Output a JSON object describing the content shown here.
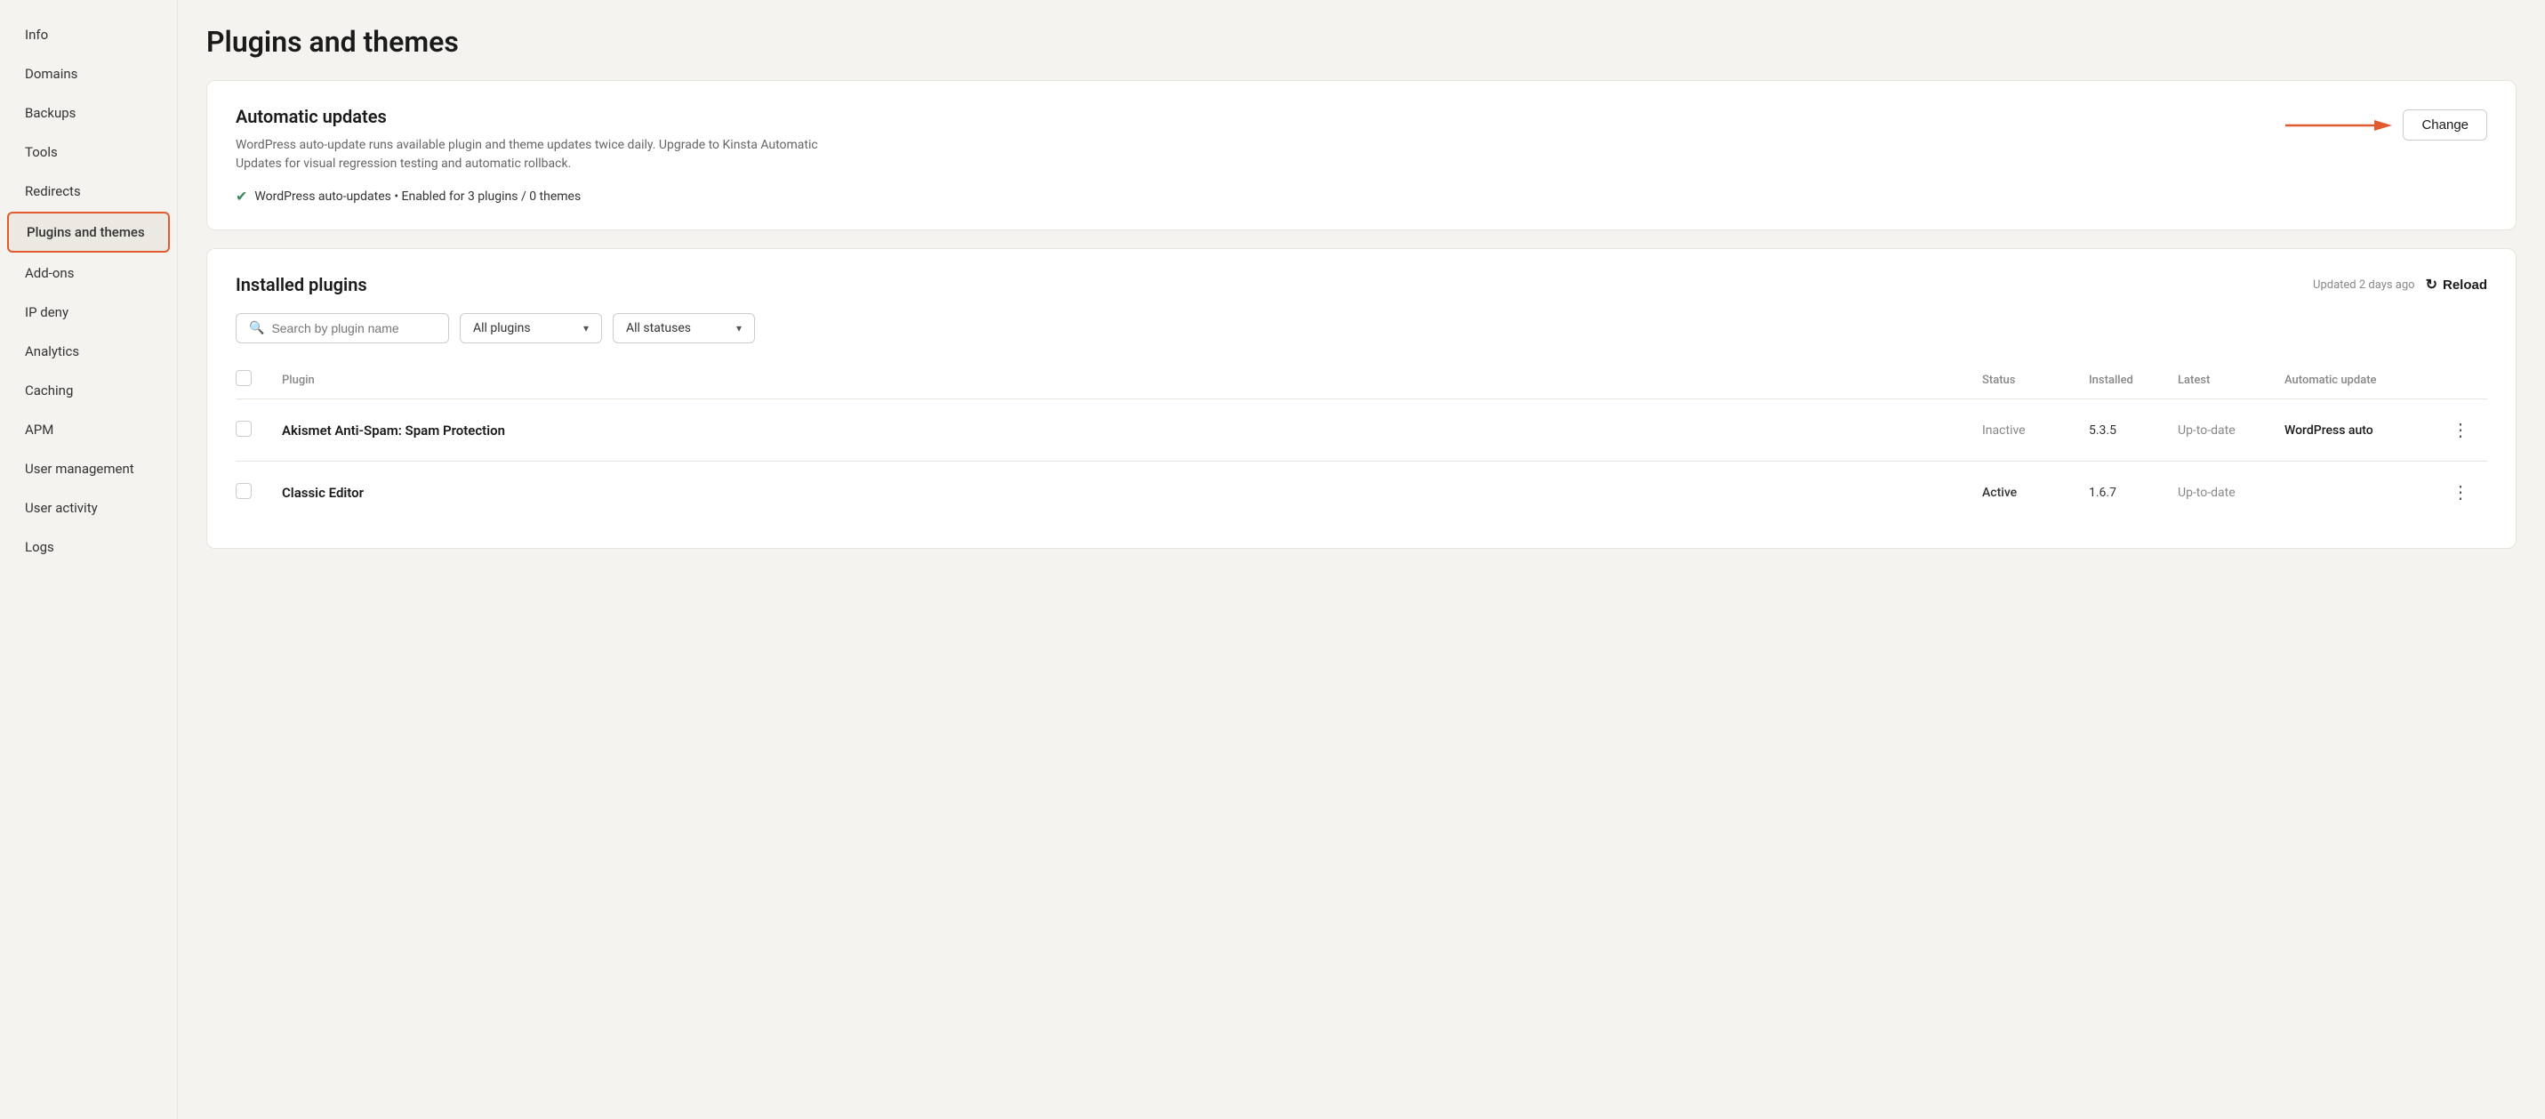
{
  "sidebar": {
    "items": [
      {
        "id": "info",
        "label": "Info",
        "active": false
      },
      {
        "id": "domains",
        "label": "Domains",
        "active": false
      },
      {
        "id": "backups",
        "label": "Backups",
        "active": false
      },
      {
        "id": "tools",
        "label": "Tools",
        "active": false
      },
      {
        "id": "redirects",
        "label": "Redirects",
        "active": false
      },
      {
        "id": "plugins-and-themes",
        "label": "Plugins and themes",
        "active": true
      },
      {
        "id": "add-ons",
        "label": "Add-ons",
        "active": false
      },
      {
        "id": "ip-deny",
        "label": "IP deny",
        "active": false
      },
      {
        "id": "analytics",
        "label": "Analytics",
        "active": false
      },
      {
        "id": "caching",
        "label": "Caching",
        "active": false
      },
      {
        "id": "apm",
        "label": "APM",
        "active": false
      },
      {
        "id": "user-management",
        "label": "User management",
        "active": false
      },
      {
        "id": "user-activity",
        "label": "User activity",
        "active": false
      },
      {
        "id": "logs",
        "label": "Logs",
        "active": false
      }
    ]
  },
  "page": {
    "title": "Plugins and themes"
  },
  "auto_updates": {
    "heading": "Automatic updates",
    "description": "WordPress auto-update runs available plugin and theme updates twice daily. Upgrade to Kinsta Automatic Updates for visual regression testing and automatic rollback.",
    "status": "WordPress auto-updates • Enabled for 3 plugins / 0 themes",
    "change_label": "Change"
  },
  "installed_plugins": {
    "heading": "Installed plugins",
    "updated_text": "Updated 2 days ago",
    "reload_label": "Reload",
    "search_placeholder": "Search by plugin name",
    "filter_plugins_label": "All plugins",
    "filter_status_label": "All statuses",
    "table_headers": {
      "plugin": "Plugin",
      "status": "Status",
      "installed": "Installed",
      "latest": "Latest",
      "auto_update": "Automatic update"
    },
    "plugins": [
      {
        "name": "Akismet Anti-Spam: Spam Protection",
        "status": "Inactive",
        "installed": "5.3.5",
        "latest": "Up-to-date",
        "auto_update": "WordPress auto"
      },
      {
        "name": "Classic Editor",
        "status": "Active",
        "installed": "1.6.7",
        "latest": "Up-to-date",
        "auto_update": ""
      }
    ]
  }
}
